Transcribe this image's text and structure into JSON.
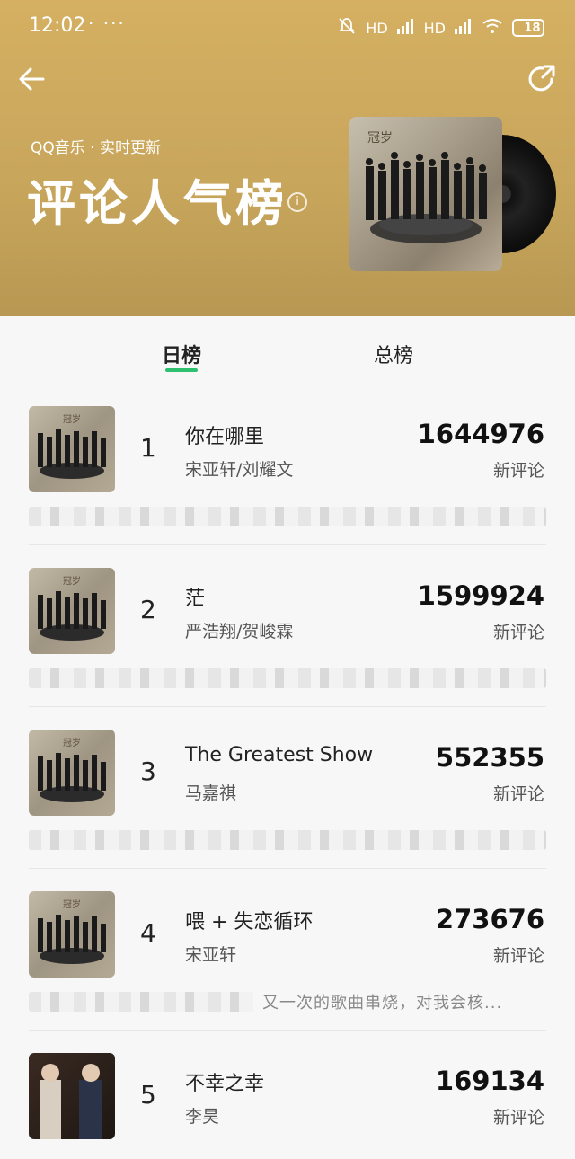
{
  "status_bar": {
    "time": "12:02",
    "extra": "· ··· ",
    "network_1": "HD",
    "network_2": "HD",
    "battery": "18",
    "battery_color": "#ff3b30"
  },
  "header": {
    "brand_line": "QQ音乐 · 实时更新",
    "title": "评论人气榜",
    "info_icon_label": "i",
    "back_icon": "arrow-left-icon",
    "share_icon": "share-icon",
    "accent_color": "#c7a55b"
  },
  "tabs": [
    {
      "label": "日榜",
      "active": true
    },
    {
      "label": "总榜",
      "active": false
    }
  ],
  "tab_underline_color": "#2fc06f",
  "chart_list": [
    {
      "rank": "1",
      "song": "你在哪里",
      "artist": "宋亚轩/刘耀文",
      "count": "1644976",
      "count_label": "新评论",
      "comment_snippet": ""
    },
    {
      "rank": "2",
      "song": "茫",
      "artist": "严浩翔/贺峻霖",
      "count": "1599924",
      "count_label": "新评论",
      "comment_snippet": ""
    },
    {
      "rank": "3",
      "song": "The Greatest Show",
      "artist": "马嘉祺",
      "count": "552355",
      "count_label": "新评论",
      "comment_snippet": ""
    },
    {
      "rank": "4",
      "song": "喂 + 失恋循环",
      "artist": "宋亚轩",
      "count": "273676",
      "count_label": "新评论",
      "comment_snippet": "又一次的歌曲串烧，对我会核..."
    },
    {
      "rank": "5",
      "song": "不幸之幸",
      "artist": "李昊",
      "count": "169134",
      "count_label": "新评论",
      "comment_snippet": ""
    }
  ]
}
